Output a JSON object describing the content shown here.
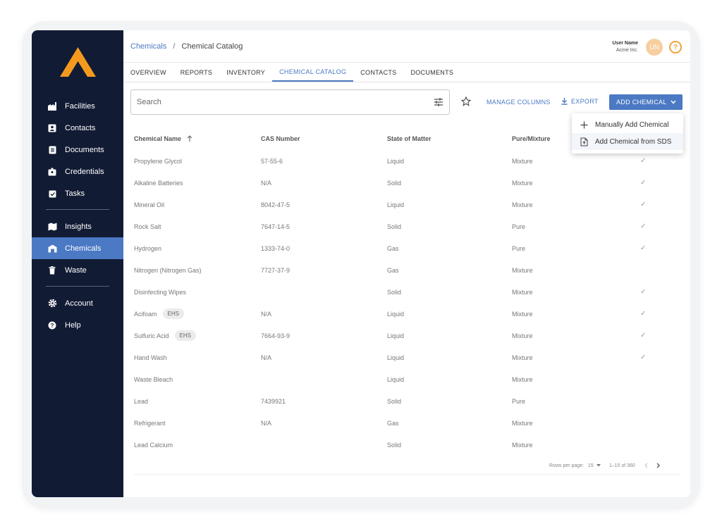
{
  "sidebar": {
    "logo_icon": "chevron-logo-icon",
    "items": [
      {
        "label": "Facilities",
        "icon": "factory-icon"
      },
      {
        "label": "Contacts",
        "icon": "contact-card-icon"
      },
      {
        "label": "Documents",
        "icon": "document-icon"
      },
      {
        "label": "Credentials",
        "icon": "badge-icon"
      },
      {
        "label": "Tasks",
        "icon": "clipboard-check-icon"
      },
      {
        "label": "Insights",
        "icon": "map-icon"
      },
      {
        "label": "Chemicals",
        "icon": "warehouse-icon"
      },
      {
        "label": "Waste",
        "icon": "trash-icon"
      },
      {
        "label": "Account",
        "icon": "gear-icon"
      },
      {
        "label": "Help",
        "icon": "help-icon"
      }
    ],
    "active": "Chemicals"
  },
  "breadcrumb": {
    "root": "Chemicals",
    "sep": "/",
    "current": "Chemical Catalog"
  },
  "user": {
    "name": "User Name",
    "org": "Acme Inc.",
    "initials": "UN",
    "help": "?"
  },
  "tabs": [
    "OVERVIEW",
    "REPORTS",
    "INVENTORY",
    "CHEMICAL CATALOG",
    "CONTACTS",
    "DOCUMENTS"
  ],
  "active_tab": "CHEMICAL CATALOG",
  "toolbar": {
    "search_placeholder": "Search",
    "manage_columns": "MANAGE COLUMNS",
    "export": "EXPORT",
    "add_chemical": "ADD CHEMICAL"
  },
  "dropdown": {
    "items": [
      "Manually Add Chemical",
      "Add Chemical from SDS"
    ]
  },
  "table": {
    "headers": [
      "Chemical Name",
      "CAS Number",
      "State of Matter",
      "Pure/Mixture"
    ],
    "rows": [
      {
        "name": "Propylene Glycol",
        "tag": "",
        "cas": "57-55-6",
        "state": "Liquid",
        "pure": "Mixture",
        "check": "✓"
      },
      {
        "name": "Alkaline Batteries",
        "tag": "",
        "cas": "N/A",
        "state": "Solid",
        "pure": "Mixture",
        "check": "✓"
      },
      {
        "name": "Mineral Oil",
        "tag": "",
        "cas": "8042-47-5",
        "state": "Liquid",
        "pure": "Mixture",
        "check": "✓"
      },
      {
        "name": "Rock Salt",
        "tag": "",
        "cas": "7647-14-5",
        "state": "Solid",
        "pure": "Pure",
        "check": "✓"
      },
      {
        "name": "Hydrogen",
        "tag": "",
        "cas": "1333-74-0",
        "state": "Gas",
        "pure": "Pure",
        "check": "✓"
      },
      {
        "name": "Nitrogen (Nitrogen Gas)",
        "tag": "",
        "cas": "7727-37-9",
        "state": "Gas",
        "pure": "Mixture",
        "check": ""
      },
      {
        "name": "Disinfecting Wipes",
        "tag": "",
        "cas": "",
        "state": "Solid",
        "pure": "Mixture",
        "check": "✓"
      },
      {
        "name": "Acifoam",
        "tag": "EHS",
        "cas": "N/A",
        "state": "Liquid",
        "pure": "Mixture",
        "check": "✓"
      },
      {
        "name": "Sulfuric Acid",
        "tag": "EHS",
        "cas": "7664-93-9",
        "state": "Liquid",
        "pure": "Mixture",
        "check": "✓"
      },
      {
        "name": "Hand Wash",
        "tag": "",
        "cas": "N/A",
        "state": "Liquid",
        "pure": "Mixture",
        "check": "✓"
      },
      {
        "name": "Waste Bleach",
        "tag": "",
        "cas": "",
        "state": "Liquid",
        "pure": "Mixture",
        "check": ""
      },
      {
        "name": "Lead",
        "tag": "",
        "cas": "7439921",
        "state": "Solid",
        "pure": "Pure",
        "check": ""
      },
      {
        "name": "Refrigerant",
        "tag": "",
        "cas": "N/A",
        "state": "Gas",
        "pure": "Mixture",
        "check": ""
      },
      {
        "name": "Lead Calcium",
        "tag": "",
        "cas": "",
        "state": "Solid",
        "pure": "Mixture",
        "check": ""
      }
    ]
  },
  "pagination": {
    "rows_label": "Rows per page:",
    "rows_value": "15",
    "range": "1–15 of 360"
  },
  "colors": {
    "sidebar": "#121b34",
    "accent": "#4b79c4",
    "logo": "#f39a1e"
  }
}
